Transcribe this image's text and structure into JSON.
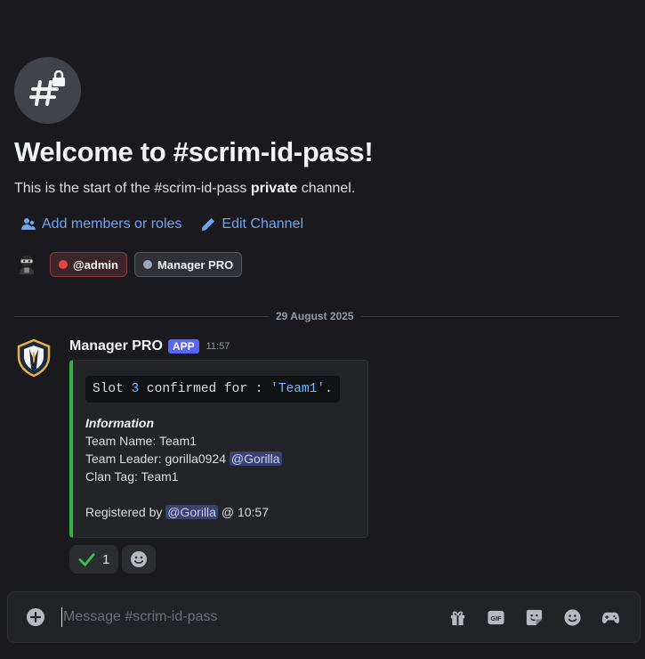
{
  "channel": {
    "welcome_title": "Welcome to #scrim-id-pass!",
    "welcome_prefix": "This is the start of the #scrim-id-pass ",
    "welcome_bold": "private",
    "welcome_suffix": " channel.",
    "icon": "hash-lock-icon"
  },
  "actions": {
    "add_members": "Add members or roles",
    "edit_channel": "Edit Channel"
  },
  "roles": [
    {
      "label": "@admin",
      "color": "#ed4245"
    },
    {
      "label": "Manager PRO",
      "color": "#99aab5"
    }
  ],
  "divider": {
    "date": "29 August 2025"
  },
  "message": {
    "author": "Manager PRO",
    "badge": "APP",
    "time": "11:57",
    "embed": {
      "accent": "#2fb347",
      "code_prefix": "Slot ",
      "code_number": "3",
      "code_middle": " confirmed for : ",
      "code_string": "'Team1'",
      "code_suffix": ".",
      "title": "Information",
      "team_name": "Team Name: Team1",
      "team_leader_prefix": "Team Leader: gorilla0924 ",
      "team_leader_mention": "@Gorilla",
      "clan_tag": "Clan Tag: Team1",
      "registered_prefix": "Registered by ",
      "registered_mention": "@Gorilla",
      "registered_suffix": " @ 10:57"
    },
    "reactions": [
      {
        "emoji": "check-mark-icon",
        "count": "1"
      }
    ]
  },
  "composer": {
    "placeholder": "Message #scrim-id-pass",
    "gif_label": "GIF"
  }
}
